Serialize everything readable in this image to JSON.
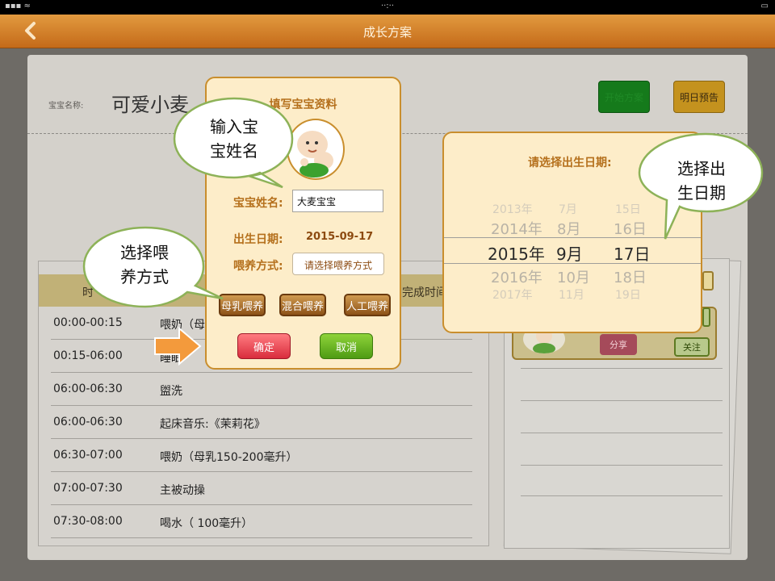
{
  "nav": {
    "title": "成长方案"
  },
  "main": {
    "baby_label": "宝宝名称:",
    "baby_name": "可爱小麦",
    "btn_start": "开始方案",
    "btn_tomorrow": "明日预告",
    "table_headers": {
      "time": "时",
      "done": "完成时间"
    },
    "rows": [
      {
        "time": "00:00-00:15",
        "activity": "喂奶（母"
      },
      {
        "time": "00:15-06:00",
        "activity": "睡眠"
      },
      {
        "time": "06:00-06:30",
        "activity": "盥洗"
      },
      {
        "time": "06:00-06:30",
        "activity": "起床音乐:《茉莉花》"
      },
      {
        "time": "06:30-07:00",
        "activity": "喂奶（母乳150-200毫升）"
      },
      {
        "time": "07:00-07:30",
        "activity": "主被动操"
      },
      {
        "time": "07:30-08:00",
        "activity": "喝水（ 100毫升）"
      }
    ],
    "card": {
      "share": "分享",
      "follow": "关注"
    }
  },
  "modal": {
    "title": "填写宝宝资料",
    "name_label": "宝宝姓名:",
    "name_value": "大麦宝宝",
    "date_label": "出生日期:",
    "date_value": "2015-09-17",
    "feed_label": "喂养方式:",
    "feed_placeholder": "请选择喂养方式",
    "feed_options": [
      "母乳喂养",
      "混合喂养",
      "人工喂养"
    ],
    "ok": "确定",
    "cancel": "取消"
  },
  "picker": {
    "title": "请选择出生日期:",
    "years": [
      "2013年",
      "2014年",
      "2015年",
      "2016年",
      "2017年"
    ],
    "months": [
      "7月",
      "8月",
      "9月",
      "10月",
      "11月"
    ],
    "days": [
      "15日",
      "16日",
      "17日",
      "18日",
      "19日"
    ]
  },
  "callouts": {
    "name_hint_1": "输入宝",
    "name_hint_2": "宝姓名",
    "feed_hint_1": "选择喂",
    "feed_hint_2": "养方式",
    "date_hint_1": "选择出",
    "date_hint_2": "生日期"
  },
  "colors": {
    "nav": "#d98a30",
    "modal_bg": "#fdedc9",
    "accent": "#b5701c",
    "arrow": "#f39a3c"
  }
}
